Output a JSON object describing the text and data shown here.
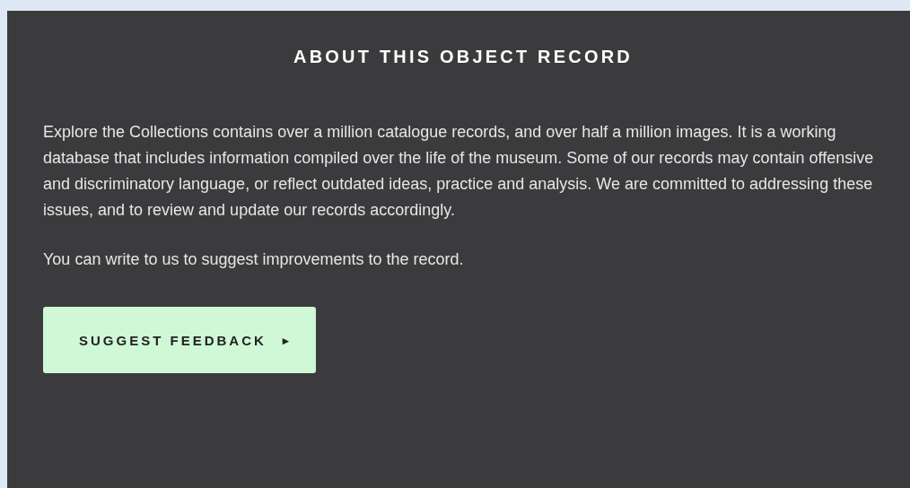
{
  "panel": {
    "title": "ABOUT THIS OBJECT RECORD",
    "paragraphs": [
      "Explore the Collections contains over a million catalogue records, and over half a million images. It is a working database that includes information compiled over the life of the museum. Some of our records may contain offensive and discriminatory language, or reflect outdated ideas, practice and analysis. We are committed to addressing these issues, and to review and update our records accordingly.",
      "You can write to us to suggest improvements to the record."
    ],
    "button": {
      "label": "SUGGEST FEEDBACK",
      "icon": "▸"
    }
  }
}
